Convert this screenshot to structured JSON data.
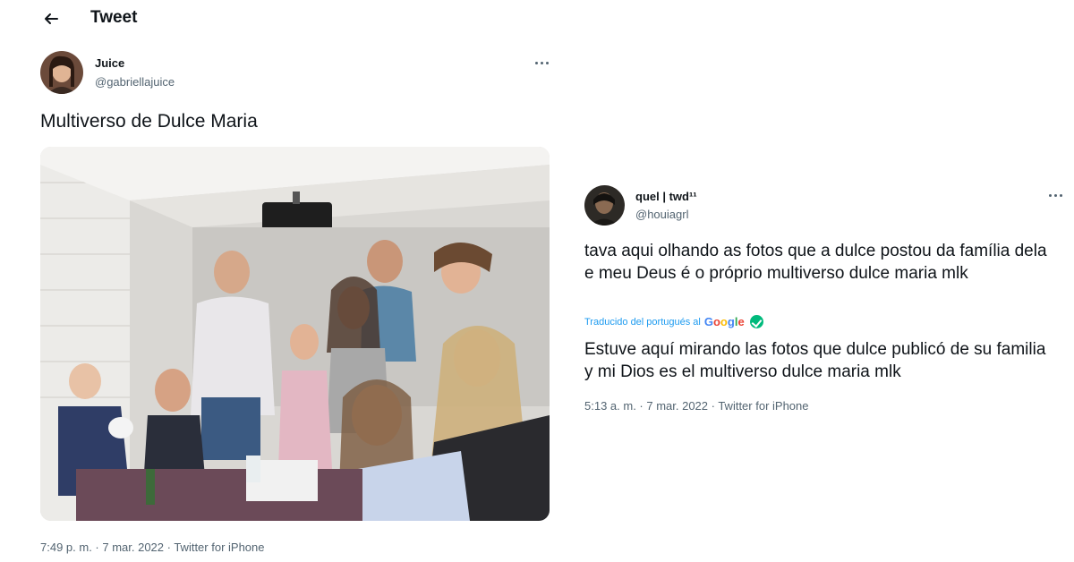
{
  "header": {
    "title": "Tweet"
  },
  "tweet1": {
    "name": "Juice",
    "handle": "@gabriellajuice",
    "text": "Multiverso de Dulce Maria",
    "meta": "7:49 p. m. · 7 mar. 2022 · Twitter for iPhone"
  },
  "tweet2": {
    "name": "quel | twd¹¹",
    "handle": "@houiagrl",
    "text": "tava aqui olhando as fotos que a dulce postou da família dela e meu Deus é o próprio multiverso dulce maria mlk",
    "translated_label": "Traducido del portugués al",
    "google_letters": [
      "G",
      "o",
      "o",
      "g",
      "l",
      "e"
    ],
    "translation": "Estuve aquí mirando las fotos que dulce publicó de su familia y mi Dios es el multiverso dulce maria mlk",
    "meta": "5:13 a. m. · 7 mar. 2022 · Twitter for iPhone"
  },
  "colors": {
    "text": "#0f1419",
    "secondary": "#536471",
    "link": "#1d9bf0",
    "verified_check": "#00ba7c"
  },
  "icons": [
    "back-arrow-icon",
    "more-icon",
    "check-icon"
  ]
}
